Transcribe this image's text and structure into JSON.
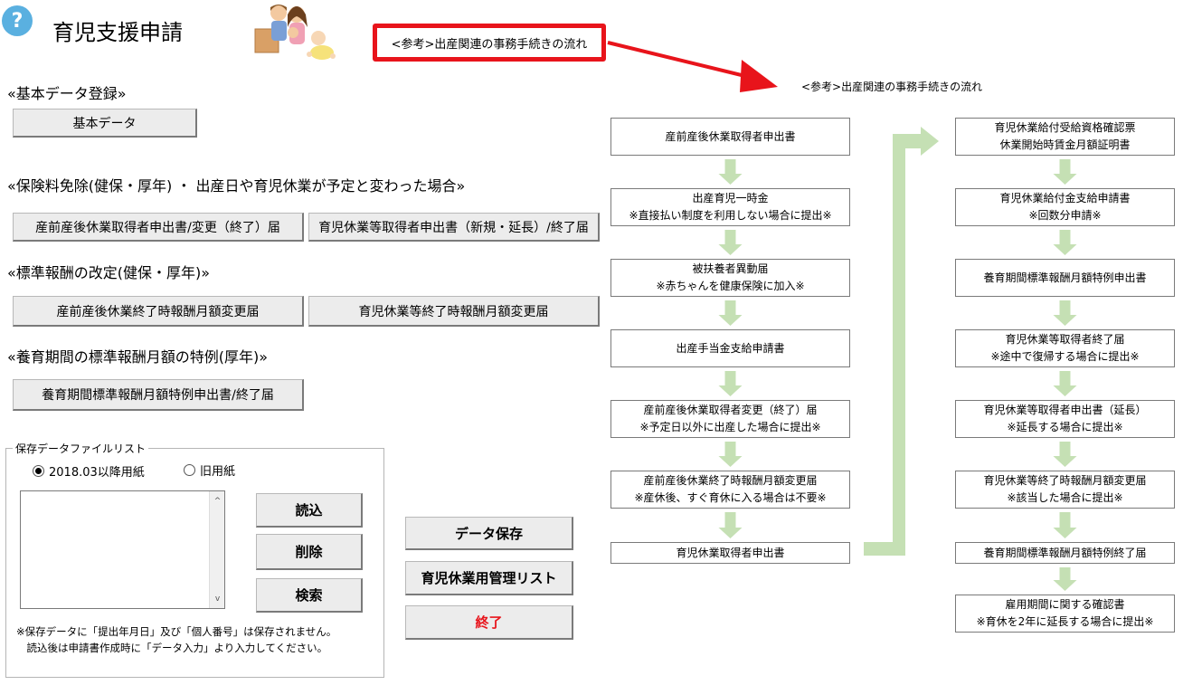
{
  "header": {
    "help_icon_glyph": "?",
    "title": "育児支援申請",
    "reference_button_label": "<参考>出産関連の事務手続きの流れ"
  },
  "sections": {
    "basic": {
      "heading": "«基本データ登録»",
      "buttons": [
        "基本データ"
      ]
    },
    "exemption": {
      "heading": "«保険料免除(健保・厚年) ・ 出産日や育児休業が予定と変わった場合»",
      "buttons": [
        "産前産後休業取得者申出書/変更（終了）届",
        "育児休業等取得者申出書（新規・延長）/終了届"
      ]
    },
    "revision": {
      "heading": "«標準報酬の改定(健保・厚年)»",
      "buttons": [
        "産前産後休業終了時報酬月額変更届",
        "育児休業等終了時報酬月額変更届"
      ]
    },
    "special": {
      "heading": "«養育期間の標準報酬月額の特例(厚年)»",
      "buttons": [
        "養育期間標準報酬月額特例申出書/終了届"
      ]
    }
  },
  "file_list": {
    "legend": "保存データファイルリスト",
    "radio_options": [
      {
        "label": "2018.03以降用紙",
        "selected": true
      },
      {
        "label": "旧用紙",
        "selected": false
      }
    ],
    "items": [],
    "scroll_up_glyph": "^",
    "scroll_down_glyph": "v",
    "buttons": {
      "load": "読込",
      "delete": "削除",
      "search": "検索"
    },
    "note_lines": [
      "※保存データに「提出年月日」及び「個人番号」は保存されません。",
      "　読込後は申請書作成時に「データ入力」より入力してください。"
    ]
  },
  "actions": {
    "save": "データ保存",
    "management_list": "育児休業用管理リスト",
    "exit": "終了"
  },
  "flowchart": {
    "label": "<参考>出産関連の事務手続きの流れ",
    "left_column": [
      [
        "産前産後休業取得者申出書"
      ],
      [
        "出産育児一時金",
        "※直接払い制度を利用しない場合に提出※"
      ],
      [
        "被扶養者異動届",
        "※赤ちゃんを健康保険に加入※"
      ],
      [
        "出産手当金支給申請書"
      ],
      [
        "産前産後休業取得者変更（終了）届",
        "※予定日以外に出産した場合に提出※"
      ],
      [
        "産前産後休業終了時報酬月額変更届",
        "※産休後、すぐ育休に入る場合は不要※"
      ],
      [
        "育児休業取得者申出書"
      ]
    ],
    "right_column": [
      [
        "育児休業給付受給資格確認票",
        "休業開始時賃金月額証明書"
      ],
      [
        "育児休業給付金支給申請書",
        "※回数分申請※"
      ],
      [
        "養育期間標準報酬月額特例申出書"
      ],
      [
        "育児休業等取得者終了届",
        "※途中で復帰する場合に提出※"
      ],
      [
        "育児休業等取得者申出書（延長）",
        "※延長する場合に提出※"
      ],
      [
        "育児休業等終了時報酬月額変更届",
        "※該当した場合に提出※"
      ],
      [
        "養育期間標準報酬月額特例終了届"
      ],
      [
        "雇用期間に関する確認書",
        "※育休を2年に延長する場合に提出※"
      ]
    ]
  },
  "colors": {
    "accent_red": "#e8141b",
    "flow_arrow_green": "#c5e0b4",
    "help_blue": "#5ab0e0"
  }
}
